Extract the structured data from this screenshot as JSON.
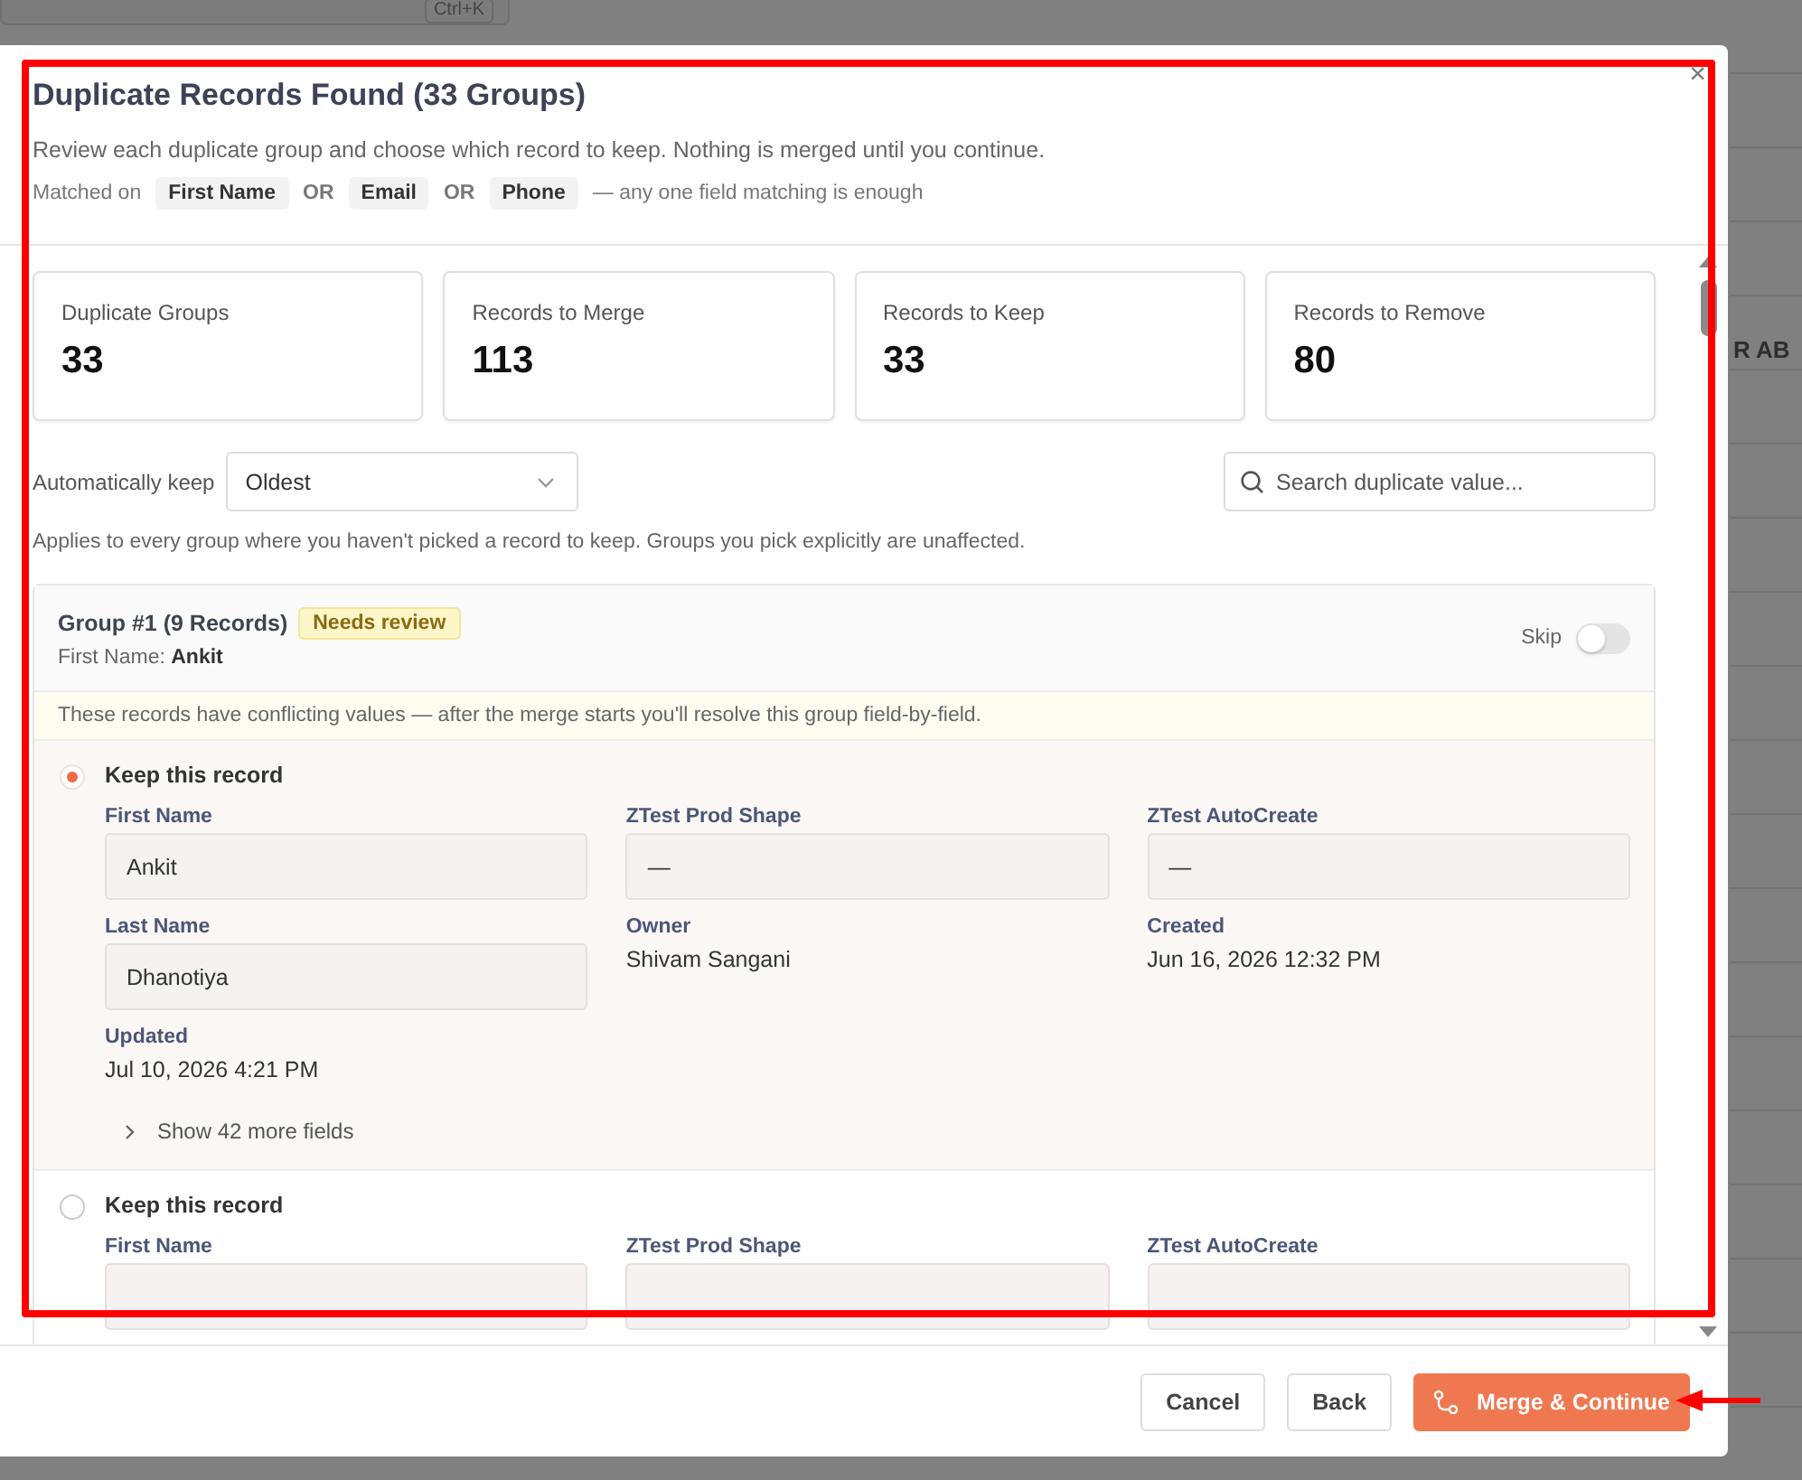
{
  "background": {
    "shortcut": "Ctrl+K",
    "column_text": "R AB"
  },
  "dialog": {
    "title": "Duplicate Records Found (33 Groups)",
    "subtitle": "Review each duplicate group and choose which record to keep. Nothing is merged until you continue.",
    "matched_label": "Matched on",
    "match_parts": [
      {
        "kind": "field",
        "text": "First Name"
      },
      {
        "kind": "operator",
        "text": "OR"
      },
      {
        "kind": "field",
        "text": "Email"
      },
      {
        "kind": "operator",
        "text": "OR"
      },
      {
        "kind": "field",
        "text": "Phone"
      }
    ],
    "match_note": "— any one field matching is enough",
    "close": "×"
  },
  "stats": [
    {
      "label": "Duplicate Groups",
      "value": "33"
    },
    {
      "label": "Records to Merge",
      "value": "113"
    },
    {
      "label": "Records to Keep",
      "value": "33"
    },
    {
      "label": "Records to Remove",
      "value": "80"
    }
  ],
  "auto_keep": {
    "label": "Automatically keep",
    "value": "Oldest"
  },
  "search": {
    "placeholder": "Search duplicate value..."
  },
  "auto_keep_note": "Applies to every group where you haven't picked a record to keep. Groups you pick explicitly are unaffected.",
  "groups": [
    {
      "title": "Group #1 (9 Records)",
      "badge": "Needs review",
      "match_label": "First Name:",
      "match_value": "Ankit",
      "skip_label": "Skip",
      "skipped": false,
      "warning": "These records have conflicting values — after the merge starts you'll resolve this group field-by-field.",
      "records": [
        {
          "selected": true,
          "keep_label": "Keep this record",
          "more_fields": "Show 42 more fields",
          "expanded": false,
          "fields": [
            {
              "kind": "input",
              "label": "First Name",
              "value": "Ankit"
            },
            {
              "kind": "input",
              "label": "ZTest Prod Shape",
              "value": "—"
            },
            {
              "kind": "input",
              "label": "ZTest AutoCreate",
              "value": "—"
            },
            {
              "kind": "input",
              "label": "Last Name",
              "value": "Dhanotiya"
            },
            {
              "kind": "text",
              "label": "Owner",
              "value": "Shivam Sangani"
            },
            {
              "kind": "text",
              "label": "Created",
              "value": "Jun 16, 2026 12:32 PM"
            },
            {
              "kind": "text",
              "label": "Updated",
              "value": "Jul 10, 2026 4:21 PM"
            }
          ]
        },
        {
          "selected": false,
          "keep_label": "Keep this record",
          "fields": [
            {
              "kind": "input",
              "label": "First Name"
            },
            {
              "kind": "input",
              "label": "ZTest Prod Shape"
            },
            {
              "kind": "input",
              "label": "ZTest AutoCreate"
            }
          ]
        }
      ]
    }
  ],
  "footer": {
    "buttons": [
      {
        "kind": "secondary",
        "label": "Cancel"
      },
      {
        "kind": "secondary",
        "label": "Back"
      },
      {
        "kind": "primary",
        "label": "Merge & Continue"
      }
    ]
  }
}
